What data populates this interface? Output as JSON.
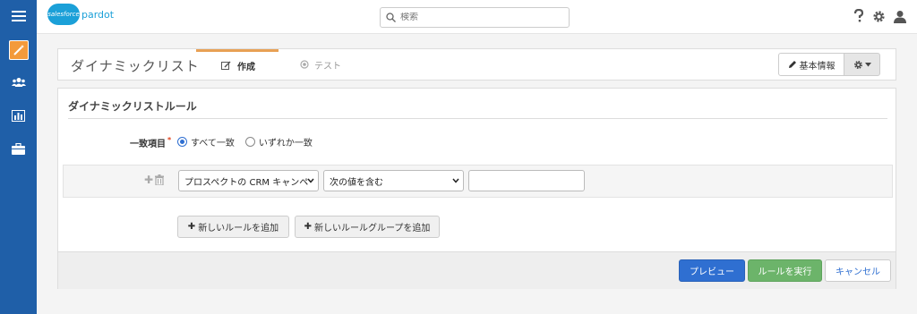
{
  "brand": {
    "logo_badge": "salesforce",
    "logo_text": "pardot",
    "color": "#1ba0d8"
  },
  "search": {
    "placeholder": "検索"
  },
  "nav": {
    "items": [
      {
        "icon": "hamburger-icon"
      },
      {
        "icon": "magic-wand-icon",
        "active": true
      },
      {
        "icon": "users-icon"
      },
      {
        "icon": "bar-chart-icon"
      },
      {
        "icon": "briefcase-icon"
      }
    ],
    "accent": "#f39a3b",
    "bg": "#1f5fa8"
  },
  "top_icons": [
    "help-icon",
    "gear-icon",
    "user-icon"
  ],
  "header": {
    "title": "ダイナミックリスト",
    "tabs": [
      {
        "label": "作成",
        "active": true,
        "icon": "edit-icon"
      },
      {
        "label": "テスト",
        "active": false,
        "icon": "circle-dot-icon"
      }
    ],
    "basic_info_label": "基本情報"
  },
  "rules": {
    "section_title": "ダイナミックリストルール",
    "match_label": "一致項目",
    "match_required": "*",
    "match_options": [
      {
        "label": "すべて一致",
        "checked": true
      },
      {
        "label": "いずれか一致",
        "checked": false
      }
    ],
    "row": {
      "field_select": "プロスペクトの CRM キャンペ",
      "operator_select": "次の値を含む",
      "value": ""
    },
    "add_rule_label": "新しいルールを追加",
    "add_group_label": "新しいルールグループを追加"
  },
  "footer": {
    "preview_label": "プレビュー",
    "run_label": "ルールを実行",
    "cancel_label": "キャンセル"
  }
}
